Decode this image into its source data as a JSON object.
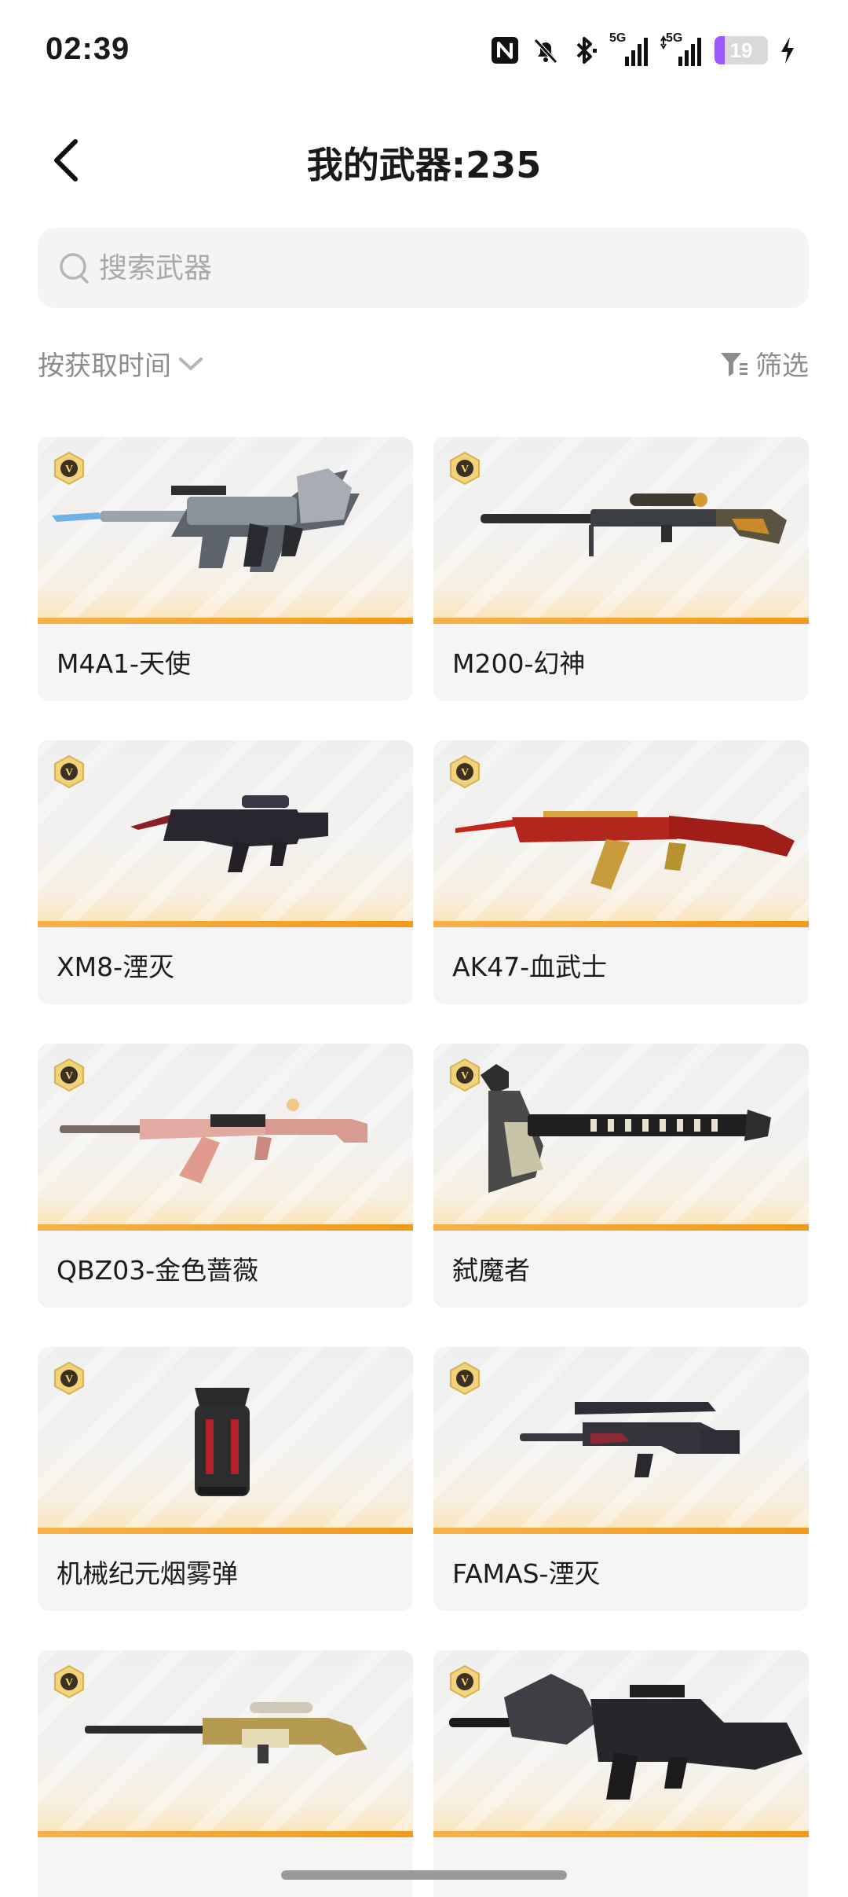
{
  "status_bar": {
    "time": "02:39",
    "battery": "19",
    "icons": [
      "nfc-icon",
      "bell-muted-icon",
      "bluetooth-icon",
      "signal-5g-icon",
      "signal-5g-icon",
      "battery-icon",
      "charging-icon"
    ],
    "signal_label_1": "5G",
    "signal_label_2": "5G"
  },
  "header": {
    "back_icon": "chevron-left-icon",
    "title": "我的武器:235"
  },
  "search": {
    "placeholder": "搜索武器",
    "value": ""
  },
  "sort": {
    "label": "按获取时间"
  },
  "filter": {
    "label": "筛选"
  },
  "colors": {
    "accent_bar": "#f19a1c",
    "battery": "#9b59ff",
    "badge": "#d8b152"
  },
  "weapons": [
    {
      "name": "M4A1-天使"
    },
    {
      "name": "M200-幻神"
    },
    {
      "name": "XM8-湮灭"
    },
    {
      "name": "AK47-血武士"
    },
    {
      "name": "QBZ03-金色蔷薇"
    },
    {
      "name": "弑魔者"
    },
    {
      "name": "机械纪元烟雾弹"
    },
    {
      "name": "FAMAS-湮灭"
    },
    {
      "name": ""
    },
    {
      "name": ""
    }
  ]
}
